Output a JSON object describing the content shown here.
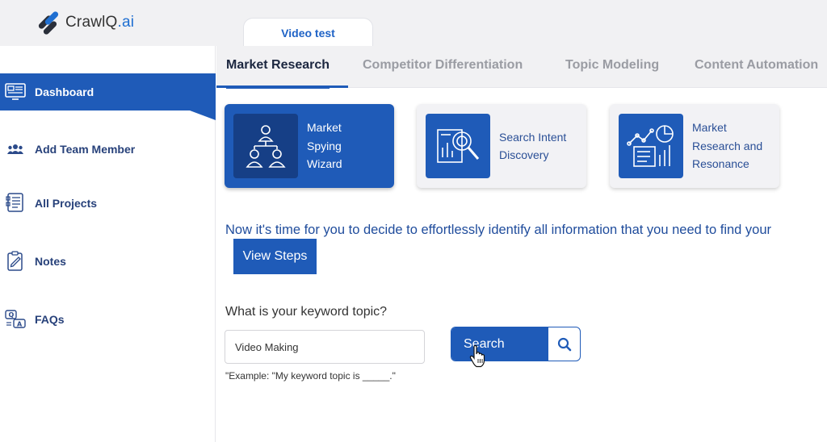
{
  "app": {
    "logo_text": "CrawlQ",
    "logo_suffix": ".ai",
    "project_tab": "Video test"
  },
  "sidebar": {
    "items": [
      {
        "label": "Dashboard",
        "icon": "dashboard-icon",
        "active": true
      },
      {
        "label": "Add Team Member",
        "icon": "team-icon",
        "active": false
      },
      {
        "label": "All Projects",
        "icon": "projects-icon",
        "active": false
      },
      {
        "label": "Notes",
        "icon": "notes-icon",
        "active": false
      },
      {
        "label": "FAQs",
        "icon": "faqs-icon",
        "active": false
      }
    ]
  },
  "tabs": [
    {
      "label": "Market Research",
      "active": true
    },
    {
      "label": "Competitor Differentiation",
      "active": false
    },
    {
      "label": "Topic Modeling",
      "active": false
    },
    {
      "label": "Content Automation",
      "active": false
    }
  ],
  "cards": [
    {
      "label_lines": [
        "Market",
        "Spying",
        "Wizard"
      ],
      "icon": "team-hierarchy-icon",
      "selected": true
    },
    {
      "label_lines": [
        "Search Intent",
        "Discovery"
      ],
      "icon": "chart-magnifier-icon",
      "selected": false
    },
    {
      "label_lines": [
        "Market",
        "Research and",
        "Resonance"
      ],
      "icon": "report-analytics-icon",
      "selected": false
    }
  ],
  "main": {
    "intro_text": "Now it's time for you to decide to effortlessly identify all information that you need to find your",
    "view_steps_label": "View Steps",
    "keyword_label": "What is your keyword topic?",
    "keyword_value": "Video Making",
    "keyword_hint": "\"Example: \"My keyword topic is _____.\"",
    "search_label": "Search"
  },
  "colors": {
    "primary": "#1f5bb8",
    "primary_dark": "#163f86",
    "text_blue": "#1f4c9c",
    "tab_inactive": "#9a9ca3"
  }
}
